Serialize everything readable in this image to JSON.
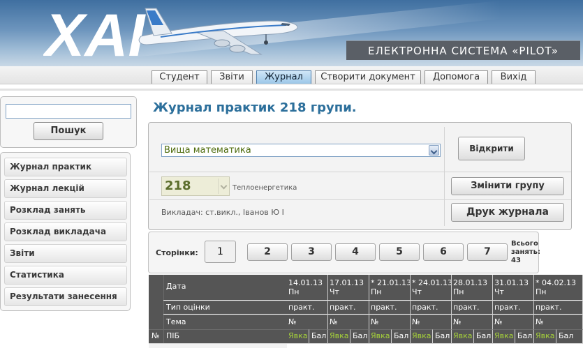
{
  "header": {
    "logo_text": "ХАІ",
    "system_title": "ЕЛЕКТРОННА СИСТЕМА «PILOT»"
  },
  "nav": {
    "tabs": [
      "Студент",
      "Звіти",
      "Журнал",
      "Створити документ",
      "Допомога",
      "Вихід"
    ],
    "active_tab": "Журнал"
  },
  "search": {
    "value": "",
    "button_label": "Пошук"
  },
  "sidebar": {
    "items": [
      "Журнал практик",
      "Журнал лекцій",
      "Розклад занять",
      "Розклад викладача",
      "Звіти",
      "Статистика",
      "Результати занесення"
    ]
  },
  "page": {
    "title": "Журнал практик 218 групи."
  },
  "controls": {
    "subject": "Вища математика",
    "open_button": "Відкрити",
    "group": "218",
    "specialty": "Теплоенергетика",
    "change_group_button": "Змінити групу",
    "teacher": "Викладач: ст.викл., Іванов Ю І",
    "print_button": "Друк журнала"
  },
  "pagination": {
    "label": "Сторінки:",
    "pages": [
      "1",
      "2",
      "3",
      "4",
      "5",
      "6",
      "7"
    ],
    "current": "1",
    "total_label_line1": "Всього",
    "total_label_line2": "занять:",
    "total_count": "43"
  },
  "journal": {
    "row_labels": {
      "date": "Дата",
      "grade_type": "Тип оцінки",
      "topic": "Тема",
      "number": "№",
      "name": "ПІБ"
    },
    "columns": [
      {
        "date": "14.01.13",
        "day": "Пн",
        "type": "практ.",
        "topic": "№"
      },
      {
        "date": "17.01.13",
        "day": "Чт",
        "type": "практ.",
        "topic": "№"
      },
      {
        "date": "* 21.01.13",
        "day": "Пн",
        "type": "практ.",
        "topic": "№"
      },
      {
        "date": "* 24.01.13",
        "day": "Чт",
        "type": "практ.",
        "topic": "№"
      },
      {
        "date": "28.01.13",
        "day": "Пн",
        "type": "практ.",
        "topic": "№"
      },
      {
        "date": "31.01.13",
        "day": "Чт",
        "type": "практ.",
        "topic": "№"
      },
      {
        "date": "* 04.02.13",
        "day": "Пн",
        "type": "практ.",
        "topic": "№"
      }
    ],
    "sub_headers": {
      "attendance": "Явка",
      "score": "Бал"
    }
  },
  "colors": {
    "title_blue": "#2c6f9b",
    "active_tab": "#9cc7e8",
    "table_dark": "#555555",
    "attendance_green": "#6a8f00"
  }
}
